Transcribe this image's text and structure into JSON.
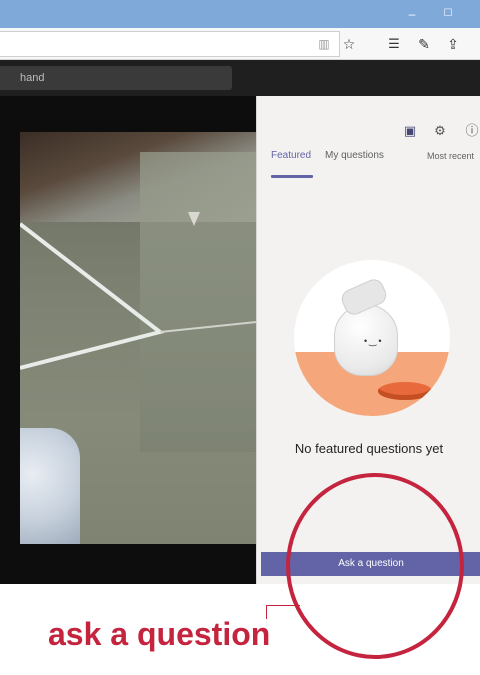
{
  "browser": {
    "minimize_glyph": "–",
    "maximize_glyph": "☐",
    "toolbar_icons": [
      "reading-view-icon",
      "star-icon",
      "favorites-icon",
      "pen-icon",
      "share-icon"
    ]
  },
  "teams": {
    "command_box_text": "hand"
  },
  "qa_panel": {
    "tabs": [
      {
        "label": "Featured",
        "active": true
      },
      {
        "label": "My questions",
        "active": false
      }
    ],
    "sort_label": "Most recent",
    "empty_state_text": "No featured questions yet",
    "ask_button_label": "Ask a question",
    "accent_color": "#6264a7"
  },
  "annotation": {
    "callout_text": "ask a question",
    "color": "#c4243d"
  }
}
